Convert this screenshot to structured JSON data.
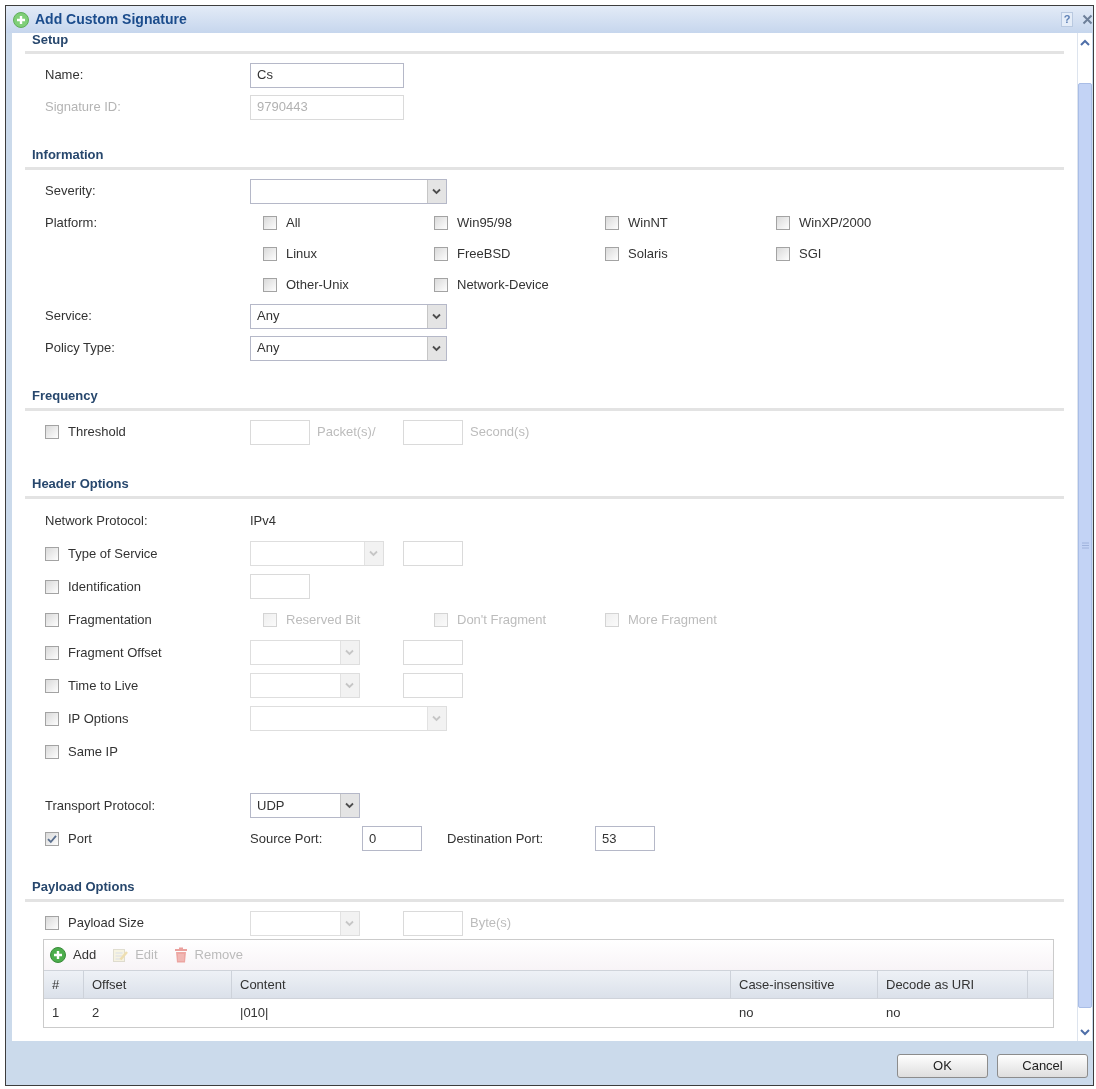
{
  "window": {
    "title": "Add Custom Signature",
    "help": "?"
  },
  "sections": [
    {
      "title": "Setup",
      "groups": [
        {
          "rows": [
            {
              "kind": "field",
              "label": "Name:",
              "disabled": false,
              "slots": [
                [
                  {
                    "kind": "text_input",
                    "value": "Cs",
                    "disabled": false
                  }
                ]
              ]
            },
            {
              "kind": "field",
              "label": "Signature ID:",
              "disabled": true,
              "slots": [
                [
                  {
                    "kind": "text_input",
                    "value": "9790443",
                    "disabled": true
                  }
                ]
              ]
            }
          ]
        }
      ]
    },
    {
      "title": "Information",
      "groups": [
        {
          "rows": [
            {
              "kind": "field",
              "label": "Severity:",
              "disabled": false,
              "slots": [
                [
                  {
                    "kind": "dropdown",
                    "disabled": false
                  }
                ]
              ]
            },
            {
              "kind": "field",
              "label": "Platform:",
              "disabled": false,
              "options": [
                {
                  "label": "All",
                  "checked": false,
                  "disabled": false
                },
                {
                  "label": "Win95/98",
                  "checked": false,
                  "disabled": false
                },
                {
                  "label": "WinNT",
                  "checked": false,
                  "disabled": false
                },
                {
                  "label": "WinXP/2000",
                  "checked": false,
                  "disabled": false
                },
                {
                  "label": "Linux",
                  "checked": false,
                  "disabled": false
                },
                {
                  "label": "FreeBSD",
                  "checked": false,
                  "disabled": false
                },
                {
                  "label": "Solaris",
                  "checked": false,
                  "disabled": false
                },
                {
                  "label": "SGI",
                  "checked": false,
                  "disabled": false
                },
                {
                  "label": "Other-Unix",
                  "checked": false,
                  "disabled": false
                },
                {
                  "label": "Network-Device",
                  "checked": false,
                  "disabled": false
                }
              ]
            },
            {
              "kind": "field",
              "label": "Service:",
              "disabled": false,
              "slots": [
                [
                  {
                    "kind": "dropdown",
                    "value": "Any",
                    "disabled": false
                  }
                ]
              ]
            },
            {
              "kind": "field",
              "label": "Policy Type:",
              "disabled": false,
              "slots": [
                [
                  {
                    "kind": "dropdown",
                    "value": "Any",
                    "disabled": false
                  }
                ]
              ]
            }
          ]
        }
      ]
    },
    {
      "title": "Frequency",
      "groups": [
        {
          "rows": [
            {
              "kind": "check",
              "label": "Threshold",
              "checked": false,
              "disabled": false,
              "slots": [
                [
                  {
                    "kind": "small_input",
                    "disabled": true
                  },
                  {
                    "kind": "unit",
                    "text": "Packet(s)/",
                    "disabled": true
                  }
                ],
                [
                  {
                    "kind": "small_input",
                    "disabled": true
                  },
                  {
                    "kind": "unit",
                    "text": "Second(s)",
                    "disabled": true
                  }
                ]
              ]
            }
          ]
        }
      ]
    },
    {
      "title": "Header Options",
      "groups": [
        {
          "rows": [
            {
              "kind": "field",
              "label": "Network Protocol:",
              "disabled": false,
              "slots": [
                [
                  {
                    "kind": "text",
                    "text": "IPv4",
                    "disabled": false
                  }
                ]
              ]
            },
            {
              "kind": "check",
              "label": "Type of Service",
              "checked": false,
              "disabled": false,
              "slots": [
                [
                  {
                    "kind": "medium_dropdown",
                    "disabled": true
                  }
                ],
                [
                  {
                    "kind": "small_input",
                    "disabled": true
                  }
                ]
              ]
            },
            {
              "kind": "check",
              "label": "Identification",
              "checked": false,
              "disabled": false,
              "slots": [
                [
                  {
                    "kind": "small_input",
                    "disabled": true
                  }
                ]
              ]
            },
            {
              "kind": "check",
              "label": "Fragmentation",
              "checked": false,
              "disabled": false,
              "options": [
                {
                  "label": "Reserved Bit",
                  "checked": false,
                  "disabled": true
                },
                {
                  "label": "Don't Fragment",
                  "checked": false,
                  "disabled": true
                },
                {
                  "label": "More Fragment",
                  "checked": false,
                  "disabled": true
                }
              ]
            },
            {
              "kind": "check",
              "label": "Fragment Offset",
              "checked": false,
              "disabled": false,
              "slots": [
                [
                  {
                    "kind": "short_dropdown",
                    "disabled": true
                  }
                ],
                [
                  {
                    "kind": "small_input",
                    "disabled": true
                  }
                ]
              ]
            },
            {
              "kind": "check",
              "label": "Time to Live",
              "checked": false,
              "disabled": false,
              "slots": [
                [
                  {
                    "kind": "short_dropdown",
                    "disabled": true
                  }
                ],
                [
                  {
                    "kind": "small_input",
                    "disabled": true
                  }
                ]
              ]
            },
            {
              "kind": "check",
              "label": "IP Options",
              "checked": false,
              "disabled": false,
              "slots": [
                [
                  {
                    "kind": "dropdown",
                    "disabled": true
                  }
                ]
              ]
            },
            {
              "kind": "check",
              "label": "Same IP",
              "checked": false,
              "disabled": false
            }
          ]
        },
        {
          "rows": [
            {
              "kind": "field",
              "label": "Transport Protocol:",
              "disabled": false,
              "slots": [
                [
                  {
                    "kind": "short_dropdown",
                    "value": "UDP",
                    "disabled": false
                  }
                ]
              ]
            },
            {
              "kind": "check",
              "label": "Port",
              "checked": true,
              "disabled": false,
              "slots": [
                [
                  {
                    "kind": "label",
                    "text": "Source Port:",
                    "disabled": false
                  },
                  {
                    "kind": "small_input",
                    "value": "0",
                    "disabled": false
                  }
                ],
                [
                  {
                    "kind": "long_label",
                    "text": "Destination Port:",
                    "disabled": false
                  },
                  {
                    "kind": "small_input",
                    "value": "53",
                    "disabled": false
                  }
                ]
              ]
            }
          ]
        }
      ]
    },
    {
      "title": "Payload Options",
      "groups": [
        {
          "rows": [
            {
              "kind": "check",
              "label": "Payload Size",
              "checked": false,
              "disabled": false,
              "slots": [
                [
                  {
                    "kind": "short_dropdown",
                    "disabled": true
                  }
                ],
                [
                  {
                    "kind": "small_input",
                    "disabled": true
                  },
                  {
                    "kind": "unit",
                    "text": "Byte(s)",
                    "disabled": true
                  }
                ]
              ]
            }
          ]
        }
      ],
      "table": {
        "toolbar": [
          {
            "kind": "add",
            "label": "Add",
            "disabled": false
          },
          {
            "kind": "edit",
            "label": "Edit",
            "disabled": true
          },
          {
            "kind": "remove",
            "label": "Remove",
            "disabled": true
          }
        ],
        "columns": [
          "#",
          "Offset",
          "Content",
          "Case-insensitive",
          "Decode as URI"
        ],
        "rows": [
          [
            "1",
            "2",
            "|010|",
            "no",
            "no"
          ]
        ]
      }
    }
  ],
  "buttons": [
    "OK",
    "Cancel"
  ]
}
